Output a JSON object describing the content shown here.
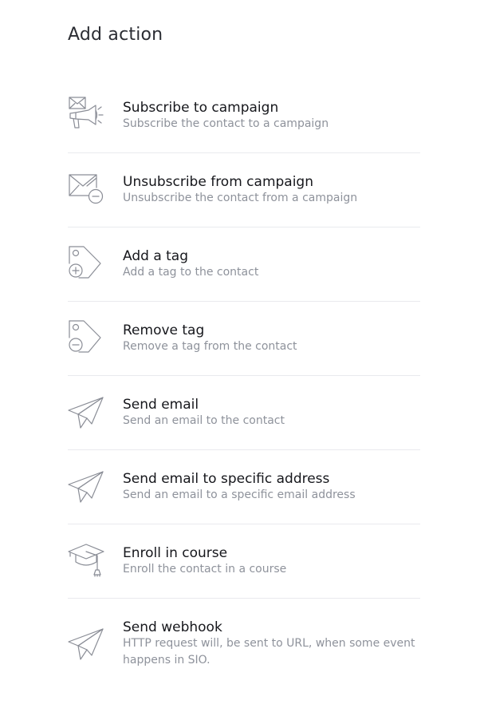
{
  "header": {
    "title": "Add action"
  },
  "actions": [
    {
      "icon": "megaphone-mail-icon",
      "title": "Subscribe to campaign",
      "description": "Subscribe the contact to a campaign"
    },
    {
      "icon": "envelope-minus-icon",
      "title": "Unsubscribe from campaign",
      "description": "Unsubscribe the contact from a campaign"
    },
    {
      "icon": "tag-plus-icon",
      "title": "Add a tag",
      "description": "Add a tag to the contact"
    },
    {
      "icon": "tag-minus-icon",
      "title": "Remove tag",
      "description": "Remove a tag from the contact"
    },
    {
      "icon": "paper-plane-icon",
      "title": "Send email",
      "description": "Send an email to the contact"
    },
    {
      "icon": "paper-plane-icon",
      "title": "Send email to specific address",
      "description": "Send an email to a specific email address"
    },
    {
      "icon": "graduation-cap-icon",
      "title": "Enroll in course",
      "description": "Enroll the contact in a course"
    },
    {
      "icon": "paper-plane-icon",
      "title": "Send webhook",
      "description": "HTTP request will, be sent to URL, when some event happens in SIO."
    }
  ],
  "colors": {
    "title": "#16171c",
    "description": "#8e929b",
    "icon_stroke": "#8a8d96",
    "divider": "#e9eaee"
  }
}
